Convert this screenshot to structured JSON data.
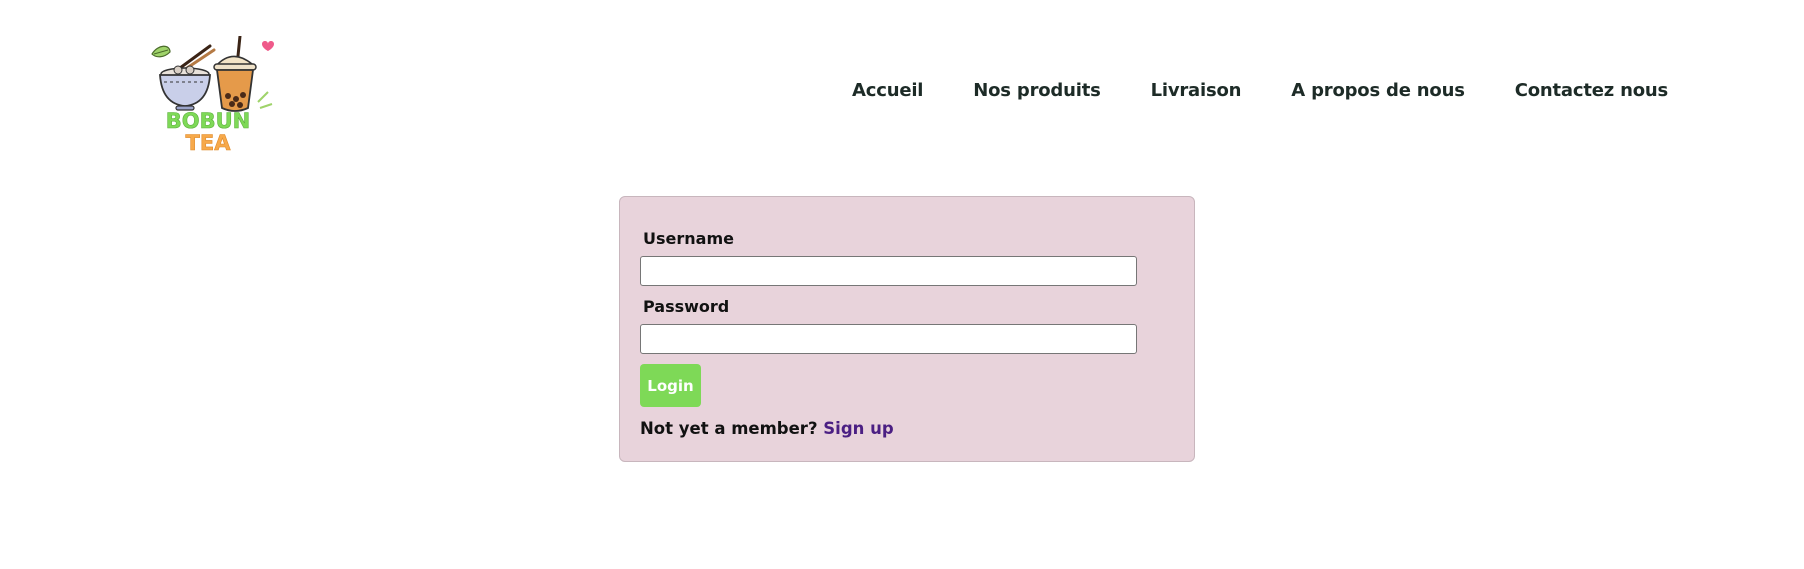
{
  "brand": {
    "logo_line1": "BOBUN",
    "logo_line2": "TEA"
  },
  "nav": {
    "items": [
      {
        "label": "Accueil"
      },
      {
        "label": "Nos produits"
      },
      {
        "label": "Livraison"
      },
      {
        "label": "A propos de nous"
      },
      {
        "label": "Contactez nous"
      }
    ]
  },
  "login": {
    "username_label": "Username",
    "username_value": "",
    "password_label": "Password",
    "password_value": "",
    "button_label": "Login",
    "prompt_text": "Not yet a member?",
    "signup_link": "Sign up"
  },
  "colors": {
    "card_bg": "#e8d3db",
    "button_bg": "#7ed957",
    "link_color": "#4b1f83",
    "nav_text": "#1d2b27",
    "logo_green": "#7ed957",
    "logo_orange": "#f7a94a"
  }
}
